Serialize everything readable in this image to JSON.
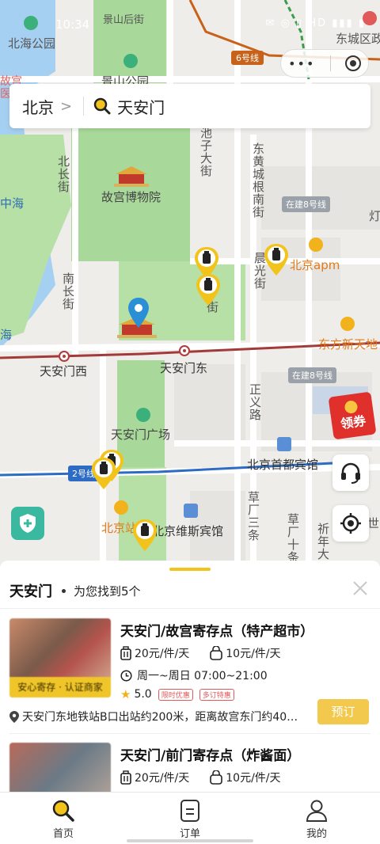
{
  "status_bar": {
    "time": "10:34",
    "icons": "✉ ◎ ▯ HD ▮▮▮ ▮"
  },
  "search": {
    "city": "北京",
    "query": "天安门"
  },
  "map": {
    "labels": {
      "beihai_park": "北海公园",
      "jingshan_street": "景山后街",
      "jingshan_park": "景山公园",
      "dongcheng": "东城区政",
      "palace_gu": "故宫",
      "palace_hospital": "医院",
      "line6": "6号线",
      "zhonghai": "中海",
      "nanhai": "海",
      "beichang": "北长街",
      "nanchang": "南长街",
      "palace_museum": "故宫博物院",
      "chizi": "池子大街",
      "donghuang": "东黄城根南街",
      "line8_top": "在建8号线",
      "chenguang": "晨光街",
      "apm": "北京apm",
      "nanchizi": "街",
      "dongfang": "东方新天地",
      "tiananmen_west": "天安门西",
      "tiananmen_east": "天安门东",
      "line8_bottom": "在建8号线",
      "zhengyi": "正义路",
      "square": "天安门广场",
      "line2": "2号线",
      "capital_hotel": "北京首都宾馆",
      "beijing_station": "北京站",
      "weisi_hotel": "北京维斯宾馆",
      "caochang3": "草厂三条",
      "caochang10": "草厂十条",
      "qiannian": "祈年大",
      "shi": "世",
      "deng": "灯"
    },
    "redpack": "领券"
  },
  "sheet": {
    "title": "天安门",
    "count": "为您找到5个",
    "items": [
      {
        "name": "天安门/故宫寄存点（特产超市）",
        "badge": "安心寄存 · 认证商家",
        "price_luggage": "20元/件/天",
        "price_bag": "10元/件/天",
        "hours": "周一~周日 07:00~21:00",
        "rating": "5.0",
        "tag1": "限时优惠",
        "tag2": "多订特惠",
        "address": "天安门东地铁站B口出站约200米，距离故宫东门约40…",
        "book": "预订"
      },
      {
        "name": "天安门/前门寄存点（炸酱面）",
        "price_luggage": "20元/件/天",
        "price_bag": "10元/件/天"
      }
    ]
  },
  "tabbar": {
    "home": "首页",
    "orders": "订单",
    "mine": "我的"
  },
  "colors": {
    "accent": "#f2c41b",
    "book": "#f2c94c",
    "park": "#a9d99a",
    "water": "#a6d0f2"
  }
}
